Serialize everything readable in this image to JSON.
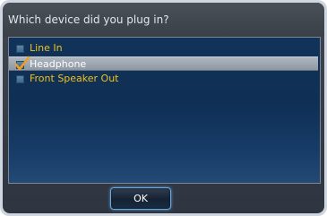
{
  "dialog": {
    "title": "Which device did you plug in?"
  },
  "options": [
    {
      "label": "Line In",
      "checked": false,
      "selected": false
    },
    {
      "label": "Headphone",
      "checked": true,
      "selected": true
    },
    {
      "label": "Front Speaker Out",
      "checked": false,
      "selected": false
    }
  ],
  "buttons": {
    "ok_label": "OK"
  },
  "colors": {
    "option_text": "#f2c018",
    "selected_text": "#ffffff",
    "check_accent": "#f0a020"
  },
  "icons": {
    "checkbox": "checkbox-icon",
    "checkmark": "checkmark-icon"
  }
}
